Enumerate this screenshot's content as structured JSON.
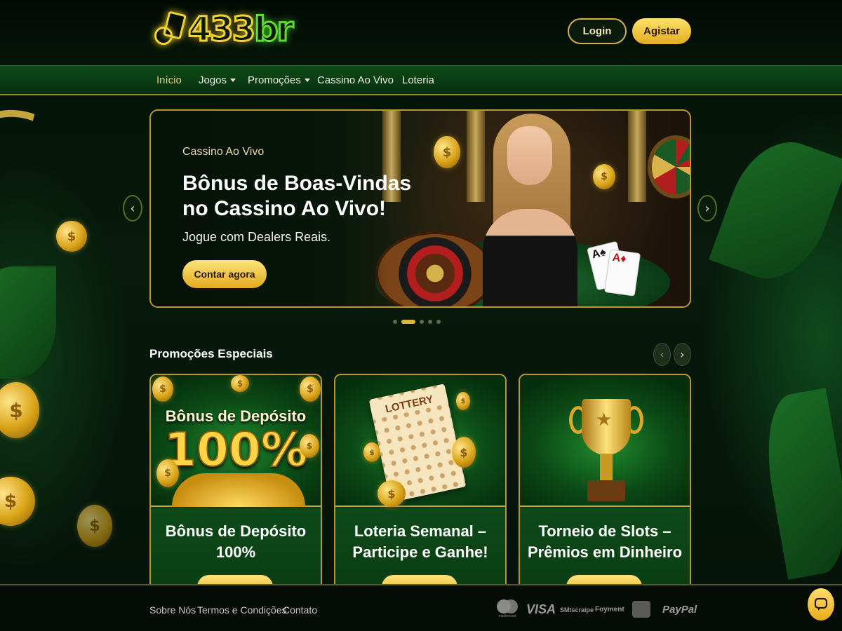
{
  "header": {
    "logo": {
      "number": "433",
      "suffix": "br"
    },
    "login_label": "Login",
    "register_label": "Agistar"
  },
  "nav": {
    "items": [
      {
        "label": "Início",
        "active": true,
        "has_dropdown": false
      },
      {
        "label": "Jogos",
        "active": false,
        "has_dropdown": true
      },
      {
        "label": "Promoções",
        "active": false,
        "has_dropdown": true
      },
      {
        "label": "Cassino Ao Vivo",
        "active": false,
        "has_dropdown": false
      },
      {
        "label": "Loteria",
        "active": false,
        "has_dropdown": false
      }
    ]
  },
  "hero": {
    "kicker": "Cassino Ao Vivo",
    "title_line1": "Bônus de Boas-Vindas",
    "title_line2": "no Cassino Ao Vivo!",
    "subtitle": "Jogue com Dealers Reais.",
    "cta_label": "Contar agora",
    "prev_icon": "chevron-left-icon",
    "next_icon": "chevron-right-icon",
    "slides_total": 5,
    "active_slide": 2
  },
  "promotions": {
    "title": "Promoções Especiais",
    "cards": [
      {
        "image_heading": "Bônus de Depósito",
        "image_big": "100%",
        "name_line1": "Bônus de Depósito",
        "name_line2": "100%"
      },
      {
        "image_label": "LOTTERY",
        "name_line1": "Loteria Semanal –",
        "name_line2": "Participe e Ganhe!"
      },
      {
        "name_line1": "Torneio de Slots –",
        "name_line2": "Prêmios em Dinheiro"
      }
    ]
  },
  "footer": {
    "links": [
      "Sobre Nós",
      "Termos e Condições",
      "Contato"
    ],
    "payments": [
      "mastercard",
      "VISA",
      "Stripe",
      "Payment",
      "PayPal"
    ],
    "payment_labels": {
      "visa": "VISA",
      "paypal": "PayPal",
      "payment": "Foyment",
      "stripe": "SMtscraipe",
      "mc_sub": "mastercard"
    }
  },
  "colors": {
    "gold": "#d9b640",
    "green_dark": "#061509",
    "green_nav": "#0d4a16",
    "logo_yellow": "#f3d333",
    "logo_green": "#5ddc2c"
  }
}
